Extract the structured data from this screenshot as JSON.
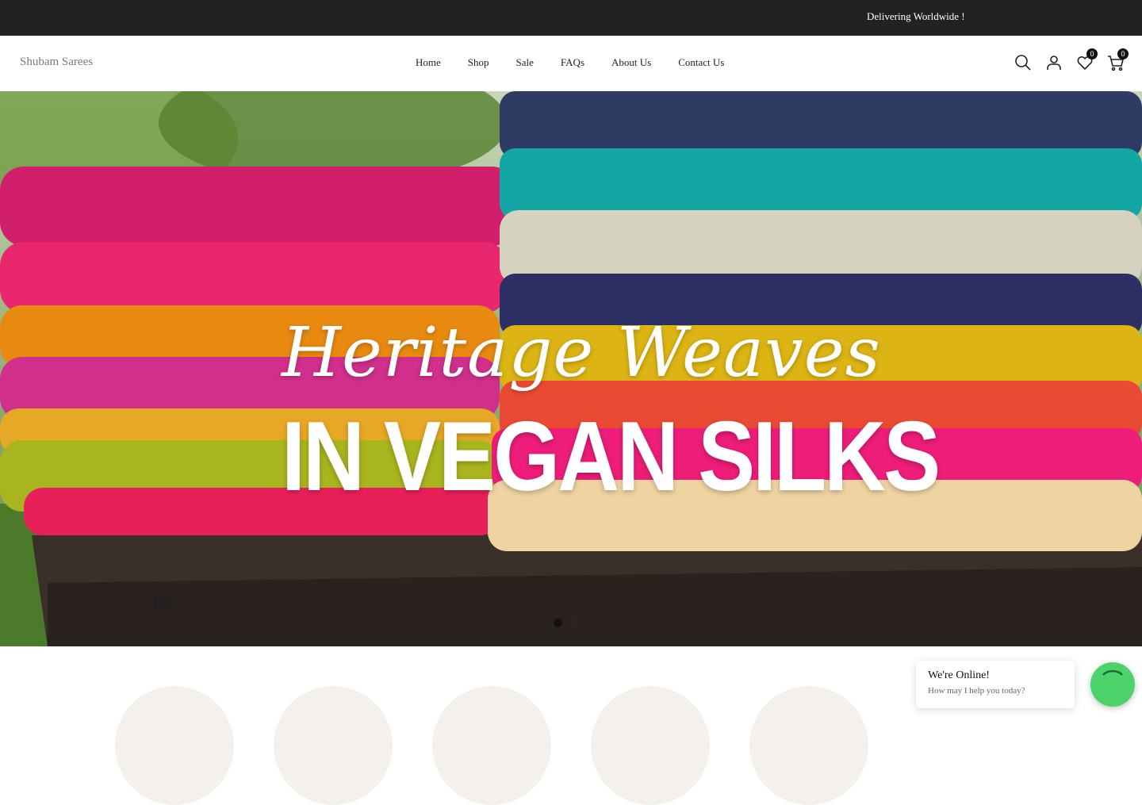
{
  "announcement": {
    "text": "Delivering Worldwide !"
  },
  "header": {
    "logo": "Shubam Sarees",
    "nav": [
      "Home",
      "Shop",
      "Sale",
      "FAQs",
      "About Us",
      "Contact Us"
    ],
    "icons": [
      "search-icon",
      "account-icon",
      "wishlist-icon",
      "cart-icon"
    ],
    "wishlist_count": "0",
    "cart_count": "0"
  },
  "hero": {
    "title_script": "Heritage Weaves",
    "title_bold": "IN VEGAN SILKS",
    "slides": 2,
    "active_slide": 1
  },
  "chat": {
    "title": "We're Online!",
    "subtitle": "How may I help you today?",
    "accent": "#4bd36a"
  },
  "colors": {
    "topbar": "#222222",
    "text": "#222222",
    "logo": "#7a7a7a"
  }
}
